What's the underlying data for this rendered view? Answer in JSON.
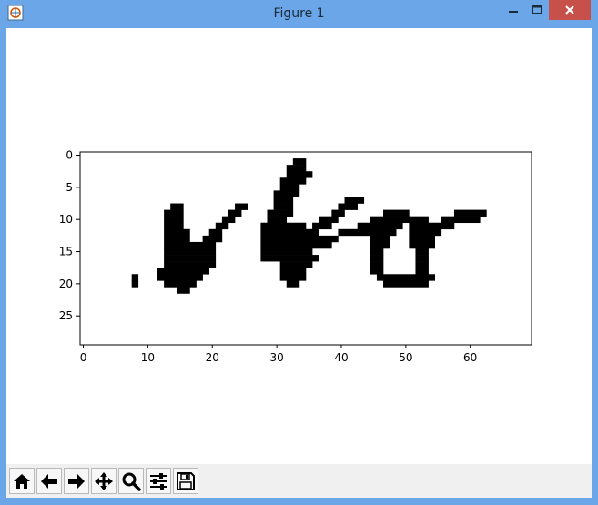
{
  "window": {
    "title": "Figure 1",
    "icons": {
      "app": "matplotlib-figure-icon",
      "minimize": "minimize-icon",
      "maximize": "maximize-icon",
      "close": "close-icon"
    },
    "colors": {
      "titlebar": "#6aa6e8",
      "close": "#c7504a"
    }
  },
  "toolbar": {
    "buttons": [
      {
        "name": "home-button",
        "icon": "home-icon"
      },
      {
        "name": "back-button",
        "icon": "arrow-left-icon"
      },
      {
        "name": "forward-button",
        "icon": "arrow-right-icon"
      },
      {
        "name": "pan-button",
        "icon": "move-icon"
      },
      {
        "name": "zoom-button",
        "icon": "magnifier-icon"
      },
      {
        "name": "configure-subplots-button",
        "icon": "sliders-icon"
      },
      {
        "name": "save-button",
        "icon": "floppy-disk-icon"
      }
    ]
  },
  "chart_data": {
    "type": "heatmap",
    "colormap": "binary",
    "shape": [
      30,
      70
    ],
    "xlim": [
      -0.5,
      69.5
    ],
    "ylim": [
      29.5,
      -0.5
    ],
    "xticks": [
      0,
      10,
      20,
      30,
      40,
      50,
      60
    ],
    "yticks": [
      0,
      5,
      10,
      15,
      20,
      25
    ],
    "grid": false,
    "pixels_on": [
      [
        1,
        33,
        34
      ],
      [
        2,
        32,
        34
      ],
      [
        3,
        32,
        35
      ],
      [
        4,
        31,
        34
      ],
      [
        5,
        31,
        33
      ],
      [
        6,
        30,
        33
      ],
      [
        7,
        30,
        32
      ],
      [
        7,
        41,
        43
      ],
      [
        8,
        14,
        15
      ],
      [
        8,
        24,
        25
      ],
      [
        8,
        30,
        32
      ],
      [
        8,
        40,
        42
      ],
      [
        9,
        13,
        15
      ],
      [
        9,
        23,
        24
      ],
      [
        9,
        29,
        32
      ],
      [
        9,
        39,
        40
      ],
      [
        9,
        47,
        50
      ],
      [
        9,
        58,
        62
      ],
      [
        10,
        13,
        15
      ],
      [
        10,
        22,
        23
      ],
      [
        10,
        29,
        31
      ],
      [
        10,
        37,
        39
      ],
      [
        10,
        45,
        53
      ],
      [
        10,
        56,
        61
      ],
      [
        11,
        13,
        15
      ],
      [
        11,
        21,
        22
      ],
      [
        11,
        28,
        34
      ],
      [
        11,
        36,
        38
      ],
      [
        11,
        43,
        49
      ],
      [
        11,
        51,
        57
      ],
      [
        12,
        13,
        16
      ],
      [
        12,
        20,
        21
      ],
      [
        12,
        28,
        36
      ],
      [
        12,
        40,
        48
      ],
      [
        12,
        51,
        55
      ],
      [
        13,
        13,
        16
      ],
      [
        13,
        19,
        21
      ],
      [
        13,
        28,
        39
      ],
      [
        13,
        45,
        47
      ],
      [
        13,
        51,
        54
      ],
      [
        14,
        13,
        20
      ],
      [
        14,
        28,
        38
      ],
      [
        14,
        45,
        47
      ],
      [
        14,
        51,
        54
      ],
      [
        15,
        13,
        20
      ],
      [
        15,
        28,
        35
      ],
      [
        15,
        45,
        46
      ],
      [
        15,
        52,
        53
      ],
      [
        16,
        13,
        20
      ],
      [
        16,
        28,
        36
      ],
      [
        16,
        45,
        46
      ],
      [
        16,
        52,
        53
      ],
      [
        17,
        13,
        20
      ],
      [
        17,
        31,
        35
      ],
      [
        17,
        45,
        46
      ],
      [
        17,
        52,
        53
      ],
      [
        18,
        12,
        19
      ],
      [
        18,
        31,
        34
      ],
      [
        18,
        45,
        46
      ],
      [
        18,
        52,
        53
      ],
      [
        19,
        8,
        8
      ],
      [
        19,
        12,
        18
      ],
      [
        19,
        31,
        34
      ],
      [
        19,
        46,
        54
      ],
      [
        20,
        8,
        8
      ],
      [
        20,
        13,
        17
      ],
      [
        20,
        32,
        33
      ],
      [
        20,
        47,
        53
      ],
      [
        21,
        15,
        16
      ]
    ]
  }
}
